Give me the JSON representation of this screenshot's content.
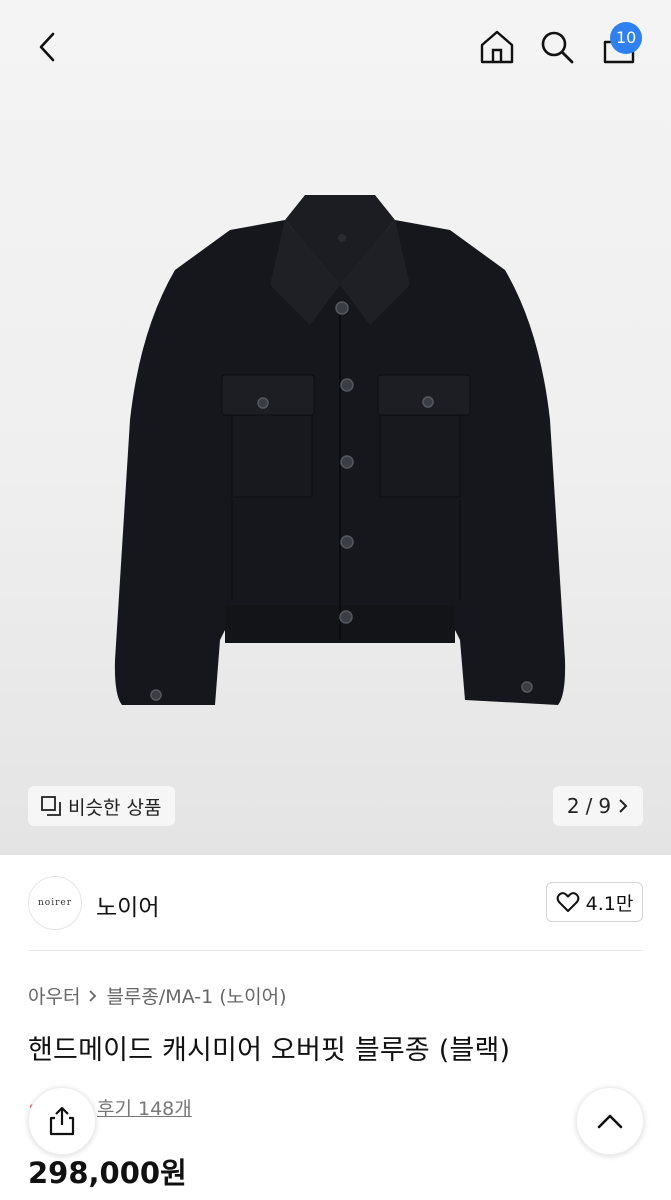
{
  "header": {
    "icons": [
      "back-icon",
      "home-icon",
      "search-icon",
      "cart-icon"
    ],
    "cart_count": "10",
    "badge_color": "#2f80f0"
  },
  "gallery": {
    "similar_label": "비슷한 상품",
    "page_current": "2",
    "page_sep": "/",
    "page_total": "9"
  },
  "brand": {
    "logo_text": "noirer",
    "name": "노이어",
    "likes": "4.1만"
  },
  "product": {
    "breadcrumb": [
      "아우터",
      "블루종/MA-1 (노이어)"
    ],
    "title": "핸드메이드 캐시미어 오버핏 블루종 (블랙)",
    "reviews": "후기 148개",
    "price": "298,000원"
  }
}
